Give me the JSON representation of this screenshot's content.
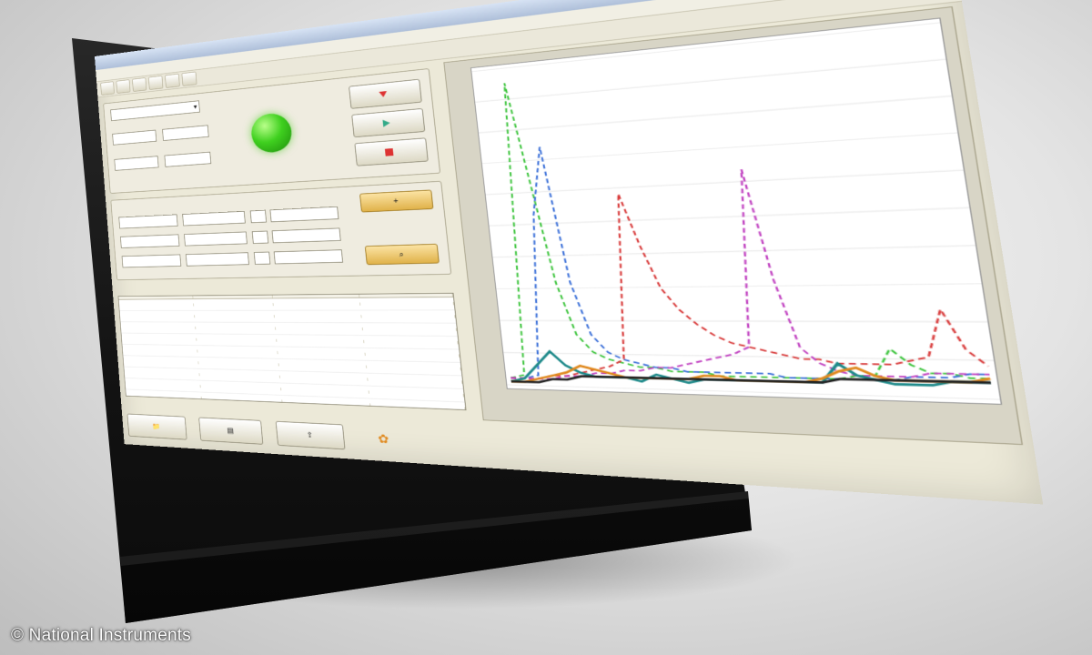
{
  "copyright": "© National Instruments",
  "window": {
    "title": "",
    "menus": [
      "",
      "",
      "",
      "",
      ""
    ],
    "controls": {
      "minimize": "",
      "maximize": "",
      "close": "✕"
    }
  },
  "acquisition": {
    "group_title": "",
    "device_select": "",
    "fields": [
      {
        "label": "",
        "value": ""
      },
      {
        "label": "",
        "value": ""
      },
      {
        "label": "",
        "value": ""
      },
      {
        "label": "",
        "value": ""
      }
    ],
    "status_label": "",
    "status_color": "#3fd01f",
    "buttons": [
      {
        "label": "",
        "icon": "download-icon"
      },
      {
        "label": "",
        "icon": "run-icon"
      },
      {
        "label": "",
        "icon": "stop-icon"
      }
    ]
  },
  "search": {
    "group_title": "",
    "columns": [
      "",
      "",
      ""
    ],
    "rows": [
      [
        "",
        "",
        ""
      ],
      [
        "",
        "",
        ""
      ],
      [
        "",
        "",
        ""
      ]
    ],
    "buttons": [
      {
        "label": "",
        "icon": "add-icon"
      },
      {
        "label": "",
        "icon": "search-icon"
      }
    ]
  },
  "results": {
    "caption": "",
    "columns": [
      "",
      "",
      "",
      ""
    ],
    "rows": [
      [
        "",
        "",
        "",
        ""
      ],
      [
        "",
        "",
        "",
        ""
      ],
      [
        "",
        "",
        "",
        ""
      ],
      [
        "",
        "",
        "",
        ""
      ],
      [
        "",
        "",
        "",
        ""
      ],
      [
        "",
        "",
        "",
        ""
      ],
      [
        "",
        "",
        "",
        ""
      ],
      [
        "",
        "",
        "",
        ""
      ],
      [
        "",
        "",
        "",
        ""
      ]
    ]
  },
  "bottom_buttons": [
    {
      "label": "",
      "icon": "folder-icon"
    },
    {
      "label": "",
      "icon": "document-icon"
    },
    {
      "label": "",
      "icon": "export-icon"
    },
    {
      "label": "",
      "icon": "settings-icon"
    }
  ],
  "chart_data": {
    "type": "line",
    "title": "",
    "xlabel": "",
    "ylabel": "",
    "grid": true,
    "legend": "none",
    "x": [
      0,
      1,
      2,
      3,
      4,
      5,
      6,
      7,
      8,
      9,
      10,
      11,
      12,
      13,
      14,
      15,
      16,
      17,
      18,
      19,
      20,
      21,
      22,
      23,
      24,
      25,
      26,
      27,
      28,
      29
    ],
    "series": [
      {
        "color": "#3cc43c",
        "dashed": true,
        "values": [
          2,
          3,
          90,
          60,
          30,
          15,
          10,
          8,
          7,
          6,
          6,
          5,
          5,
          5,
          4,
          4,
          4,
          4,
          4,
          4,
          4,
          4,
          5,
          5,
          12,
          8,
          6,
          6,
          5,
          5
        ]
      },
      {
        "color": "#3a6fd8",
        "dashed": true,
        "values": [
          2,
          2,
          3,
          50,
          70,
          30,
          15,
          10,
          8,
          7,
          6,
          6,
          5,
          5,
          5,
          5,
          5,
          5,
          4,
          4,
          4,
          4,
          4,
          4,
          4,
          5,
          5,
          5,
          6,
          6
        ]
      },
      {
        "color": "#d83a3a",
        "dashed": true,
        "values": [
          2,
          2,
          2,
          3,
          3,
          4,
          5,
          6,
          8,
          55,
          40,
          28,
          22,
          18,
          15,
          13,
          12,
          11,
          10,
          9,
          9,
          8,
          8,
          8,
          8,
          9,
          10,
          22,
          12,
          8
        ]
      },
      {
        "color": "#c040c0",
        "dashed": true,
        "values": [
          2,
          2,
          2,
          2,
          3,
          3,
          4,
          4,
          5,
          5,
          6,
          6,
          7,
          8,
          9,
          10,
          12,
          60,
          30,
          12,
          8,
          6,
          5,
          5,
          5,
          5,
          6,
          6,
          6,
          6
        ]
      },
      {
        "color": "#1f8a8a",
        "dashed": false,
        "values": [
          1,
          2,
          6,
          10,
          6,
          4,
          3,
          3,
          3,
          2,
          4,
          3,
          2,
          3,
          3,
          3,
          3,
          3,
          3,
          3,
          3,
          8,
          5,
          4,
          3,
          3,
          3,
          4,
          4,
          4
        ]
      },
      {
        "color": "#e08a20",
        "dashed": false,
        "values": [
          1,
          1,
          2,
          3,
          4,
          6,
          5,
          4,
          3,
          3,
          3,
          3,
          3,
          4,
          4,
          3,
          3,
          3,
          3,
          3,
          4,
          6,
          7,
          5,
          4,
          4,
          4,
          4,
          4,
          5
        ]
      },
      {
        "color": "#222222",
        "dashed": false,
        "values": [
          1,
          1,
          1,
          2,
          2,
          3,
          3,
          3,
          3,
          3,
          3,
          3,
          3,
          3,
          3,
          3,
          3,
          3,
          3,
          3,
          3,
          4,
          4,
          4,
          4,
          4,
          4,
          4,
          4,
          4
        ]
      }
    ]
  }
}
